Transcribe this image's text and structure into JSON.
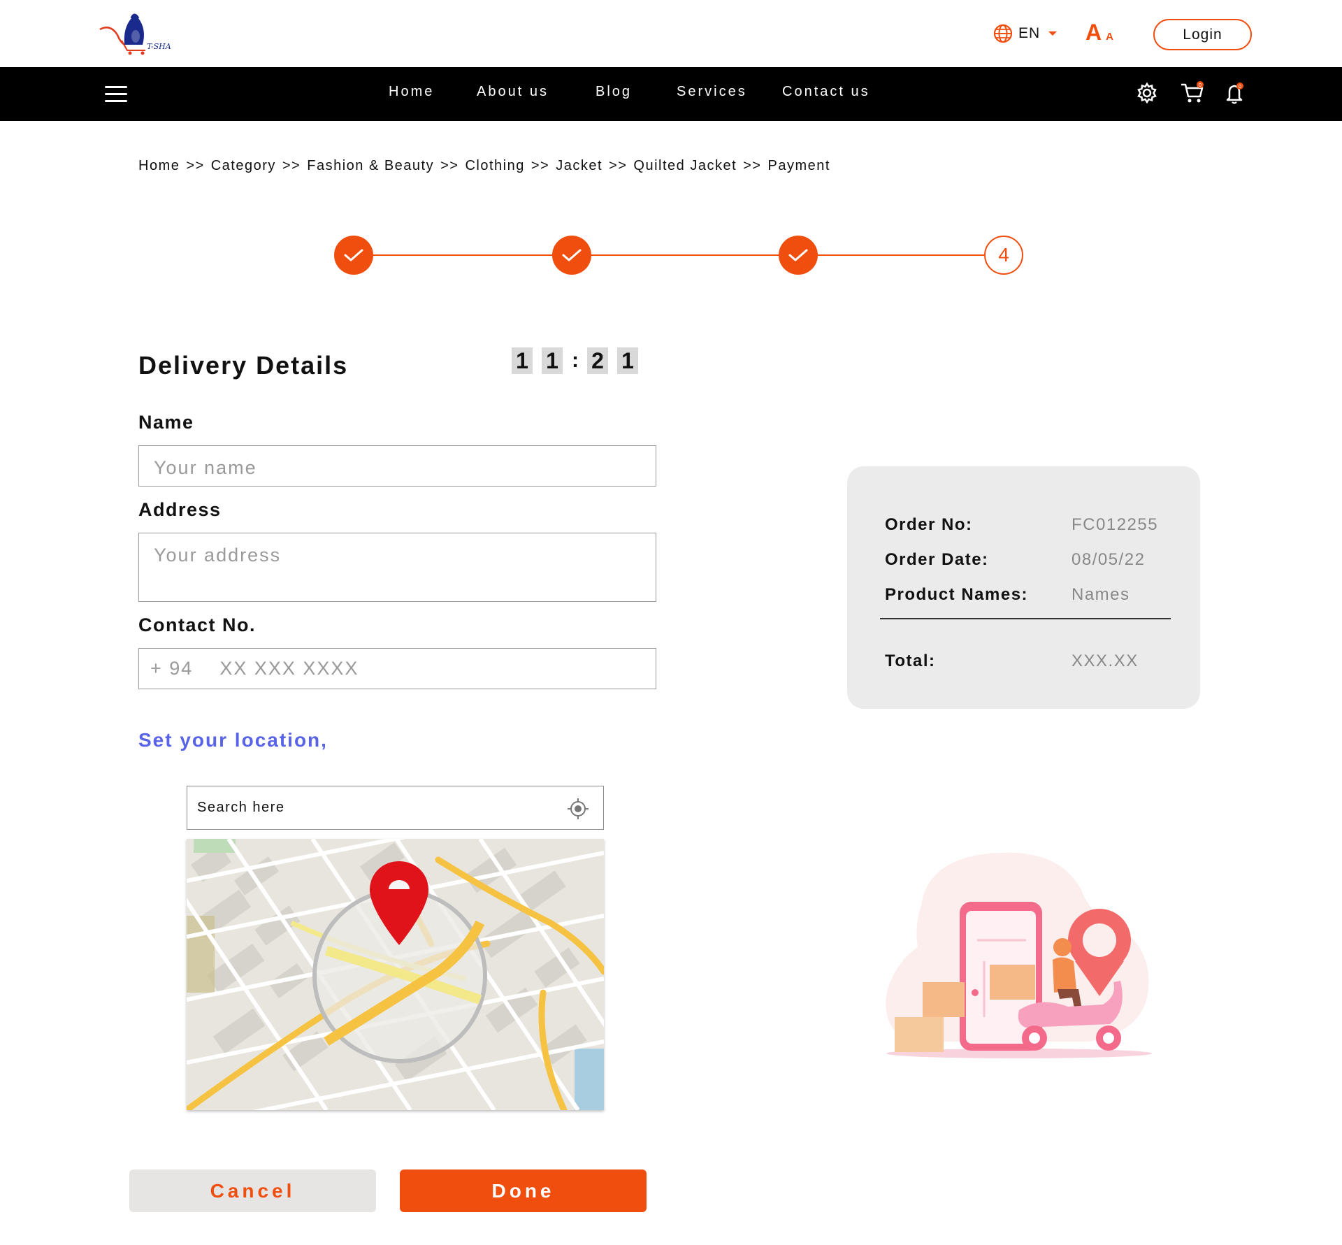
{
  "brand": {
    "logo_text": "T-SHA"
  },
  "header": {
    "language": "EN",
    "font_size_large": "A",
    "font_size_small": "A",
    "login_label": "Login"
  },
  "nav": {
    "items": [
      {
        "label": "Home"
      },
      {
        "label": "About us"
      },
      {
        "label": "Blog"
      },
      {
        "label": "Services"
      },
      {
        "label": "Contact us"
      }
    ],
    "icons": [
      "menu-icon",
      "gear-icon",
      "cart-icon",
      "bell-icon"
    ],
    "cart_badge": "0",
    "bell_badge": "0"
  },
  "breadcrumb": {
    "separator": ">>",
    "items": [
      "Home",
      "Category",
      "Fashion & Beauty",
      "Clothing",
      "Jacket",
      "Quilted Jacket",
      "Payment"
    ]
  },
  "stepper": {
    "total_steps": 4,
    "completed_steps": 3,
    "current_label": "4"
  },
  "form": {
    "title": "Delivery Details",
    "timer": {
      "d1": "1",
      "d2": "1",
      "sep": ":",
      "d3": "2",
      "d4": "1"
    },
    "name_label": "Name",
    "name_placeholder": "Your name",
    "address_label": "Address",
    "address_placeholder": "Your address",
    "contact_label": "Contact No.",
    "contact_code": "+ 94",
    "contact_placeholder": "XX XXX XXXX",
    "location_label": "Set your location,",
    "map_search_placeholder": "Search here"
  },
  "actions": {
    "cancel_label": "Cancel",
    "done_label": "Done"
  },
  "summary": {
    "order_no_label": "Order No:",
    "order_no_value": "FC012255",
    "order_date_label": "Order Date:",
    "order_date_value": "08/05/22",
    "product_names_label": "Product Names:",
    "product_names_value": "Names",
    "total_label": "Total:",
    "total_value": "XXX.XX"
  },
  "colors": {
    "accent": "#f04e0f",
    "link": "#5863e6",
    "nav_bg": "#000000",
    "card_bg": "#ebebeb"
  }
}
